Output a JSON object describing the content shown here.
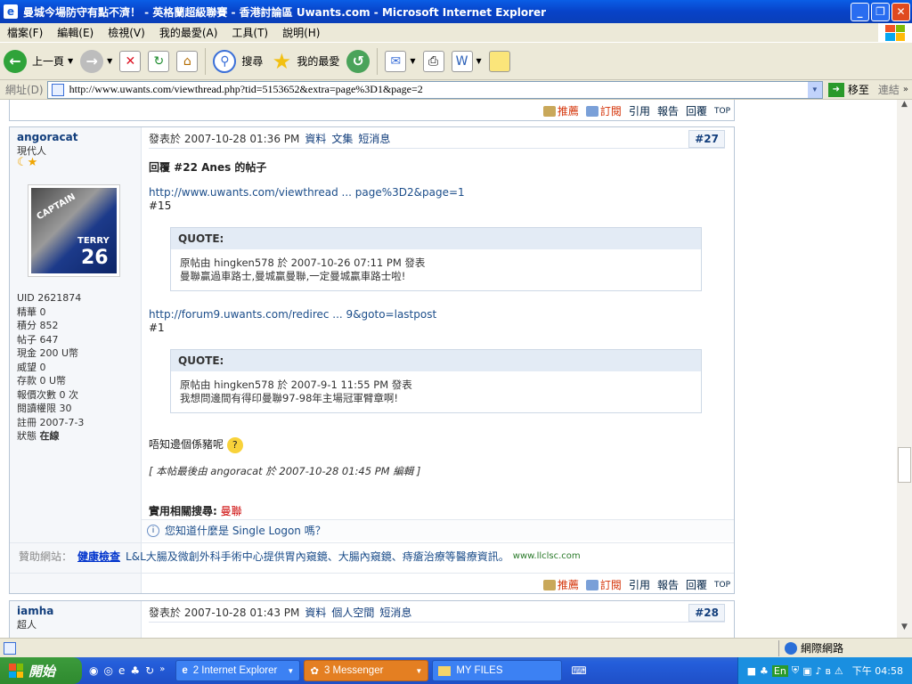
{
  "window": {
    "title": "曼城今場防守有點不濟！ - 英格蘭超級聯賽 - 香港討論區 Uwants.com - Microsoft Internet Explorer"
  },
  "menu": [
    "檔案(F)",
    "編輯(E)",
    "檢視(V)",
    "我的最愛(A)",
    "工具(T)",
    "說明(H)"
  ],
  "toolbar": {
    "back": "上一頁",
    "search": "搜尋",
    "favorites": "我的最愛"
  },
  "address": {
    "label": "網址(D)",
    "url": "http://www.uwants.com/viewthread.php?tid=5153652&extra=page%3D1&page=2",
    "go": "移至",
    "links": "連結"
  },
  "opbar": [
    "推薦",
    "訂閱",
    "引用",
    "報告",
    "回覆",
    "TOP"
  ],
  "post1": {
    "author": "angoracat",
    "rank": "現代人",
    "stars": "☾★",
    "avatar_text": {
      "captain": "CAPTAIN",
      "terry": "TERRY",
      "num": "26"
    },
    "stats": [
      "UID 2621874",
      "精華 0",
      "積分 852",
      "帖子 647",
      "現金 200 U幣",
      "威望 0",
      "存款 0 U幣",
      "報價次數 0 次",
      "閱讀權限 30",
      "註冊 2007-7-3"
    ],
    "status_label": "狀態",
    "status_value": "在線",
    "date": "發表於 2007-10-28 01:36 PM",
    "links": [
      "資料",
      "文集",
      "短消息"
    ],
    "num": "#27",
    "title": "回覆 #22 Anes 的帖子",
    "link1": "http://www.uwants.com/viewthread ... page%3D2&page=1",
    "ref1": "#15",
    "quote1": {
      "head": "QUOTE:",
      "line1": "原帖由 hingken578 於 2007-10-26 07:11 PM 發表",
      "line2": "曼聯贏過車路士,曼城贏曼聯,一定曼城贏車路士啦!"
    },
    "link2": "http://forum9.uwants.com/redirec ... 9&goto=lastpost",
    "ref2": "#1",
    "quote2": {
      "head": "QUOTE:",
      "line1": "原帖由 hingken578 於 2007-9-1 11:55 PM 發表",
      "line2": "我想問邊間有得印曼聯97-98年主場冠軍臂章啊!"
    },
    "body": "唔知邊個係豬呢",
    "edit": "[ 本帖最後由 angoracat 於 2007-10-28 01:45 PM 編輯 ]",
    "related_label": "實用相關搜尋:",
    "related_value": "曼聯",
    "single_logon": "您知道什麼是 Single Logon 嗎？"
  },
  "sponsor": {
    "label": "贊助網站：",
    "title": "健康檢查",
    "desc": "L&L大腸及微創外科手術中心提供胃內窺鏡、大腸內窺鏡、痔瘡治療等醫療資訊。",
    "url": "www.llclsc.com"
  },
  "post2": {
    "author": "iamha",
    "rank": "超人",
    "date": "發表於 2007-10-28 01:43 PM",
    "links": [
      "資料",
      "個人空間",
      "短消息"
    ],
    "num": "#28"
  },
  "status": {
    "zone": "網際網路"
  },
  "taskbar": {
    "start": "開始",
    "items": [
      "2 Internet Explorer",
      "3 Messenger",
      "MY FILES"
    ],
    "clock": "下午 04:58",
    "lang": "En"
  }
}
